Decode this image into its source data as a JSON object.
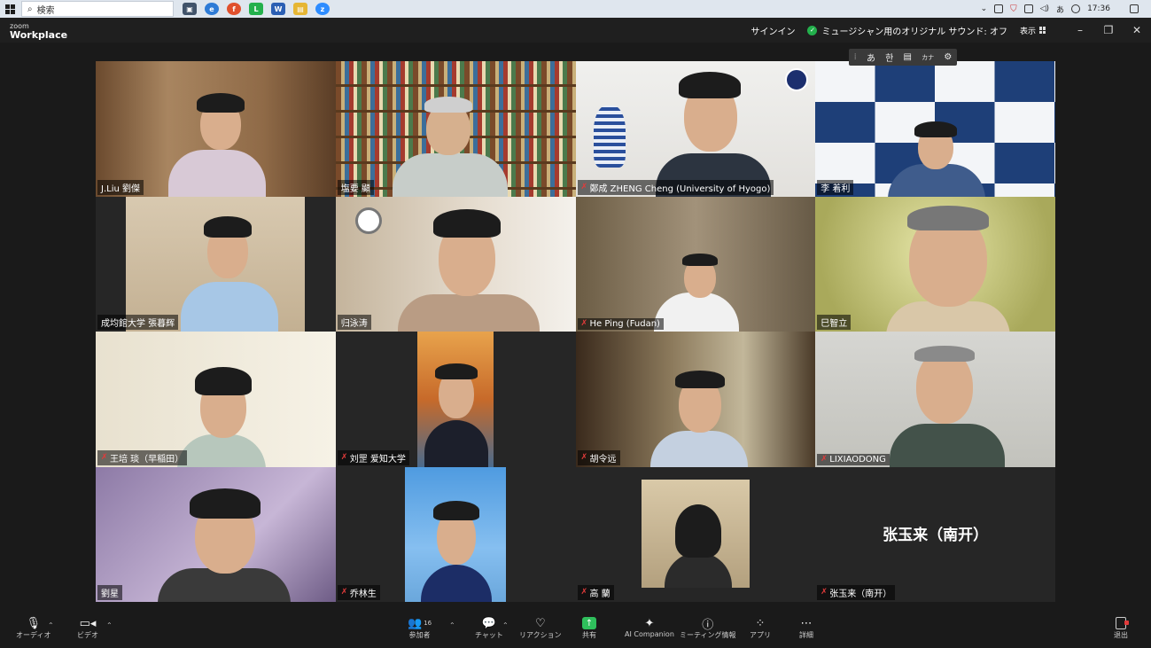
{
  "taskbar": {
    "search_placeholder": "検索",
    "clock": "17:36",
    "ime": "あ"
  },
  "titlebar": {
    "logo_small": "zoom",
    "logo_main": "Workplace",
    "signin": "サインイン",
    "sound_status": "ミュージシャン用のオリジナル サウンド: オフ",
    "view_label": "表示"
  },
  "ime_toolbar": {
    "items": [
      "あ",
      "한",
      "カナ"
    ]
  },
  "participants": [
    {
      "name": "J.Liu 劉傑",
      "muted": false
    },
    {
      "name": "塩要 顯",
      "muted": false
    },
    {
      "name": "鄭成 ZHENG Cheng (University of Hyogo)",
      "muted": true
    },
    {
      "name": "李 着利",
      "muted": false
    },
    {
      "name": "成均館大学 張暮辉",
      "muted": false
    },
    {
      "name": "归泳涛",
      "muted": false
    },
    {
      "name": "He Ping (Fudan)",
      "muted": true
    },
    {
      "name": "巳智立",
      "muted": false
    },
    {
      "name": "王培 琰（早稲田）",
      "muted": true
    },
    {
      "name": "刘罡 爱知大学",
      "muted": true
    },
    {
      "name": "胡令远",
      "muted": true
    },
    {
      "name": "LIXIAODONG",
      "muted": true
    },
    {
      "name": "劉星",
      "muted": false
    },
    {
      "name": "乔林生",
      "muted": true
    },
    {
      "name": "高 蘭",
      "muted": true
    },
    {
      "name": "张玉来（南开）",
      "muted": true
    }
  ],
  "big_name": "张玉来（南开）",
  "toolbar": {
    "audio": "オーディオ",
    "video": "ビデオ",
    "participants": "参加者",
    "participant_count": "16",
    "chat": "チャット",
    "reaction": "リアクション",
    "share": "共有",
    "ai": "AI Companion",
    "meeting_info": "ミーティング情報",
    "apps": "アプリ",
    "more": "詳細",
    "leave": "退出"
  }
}
